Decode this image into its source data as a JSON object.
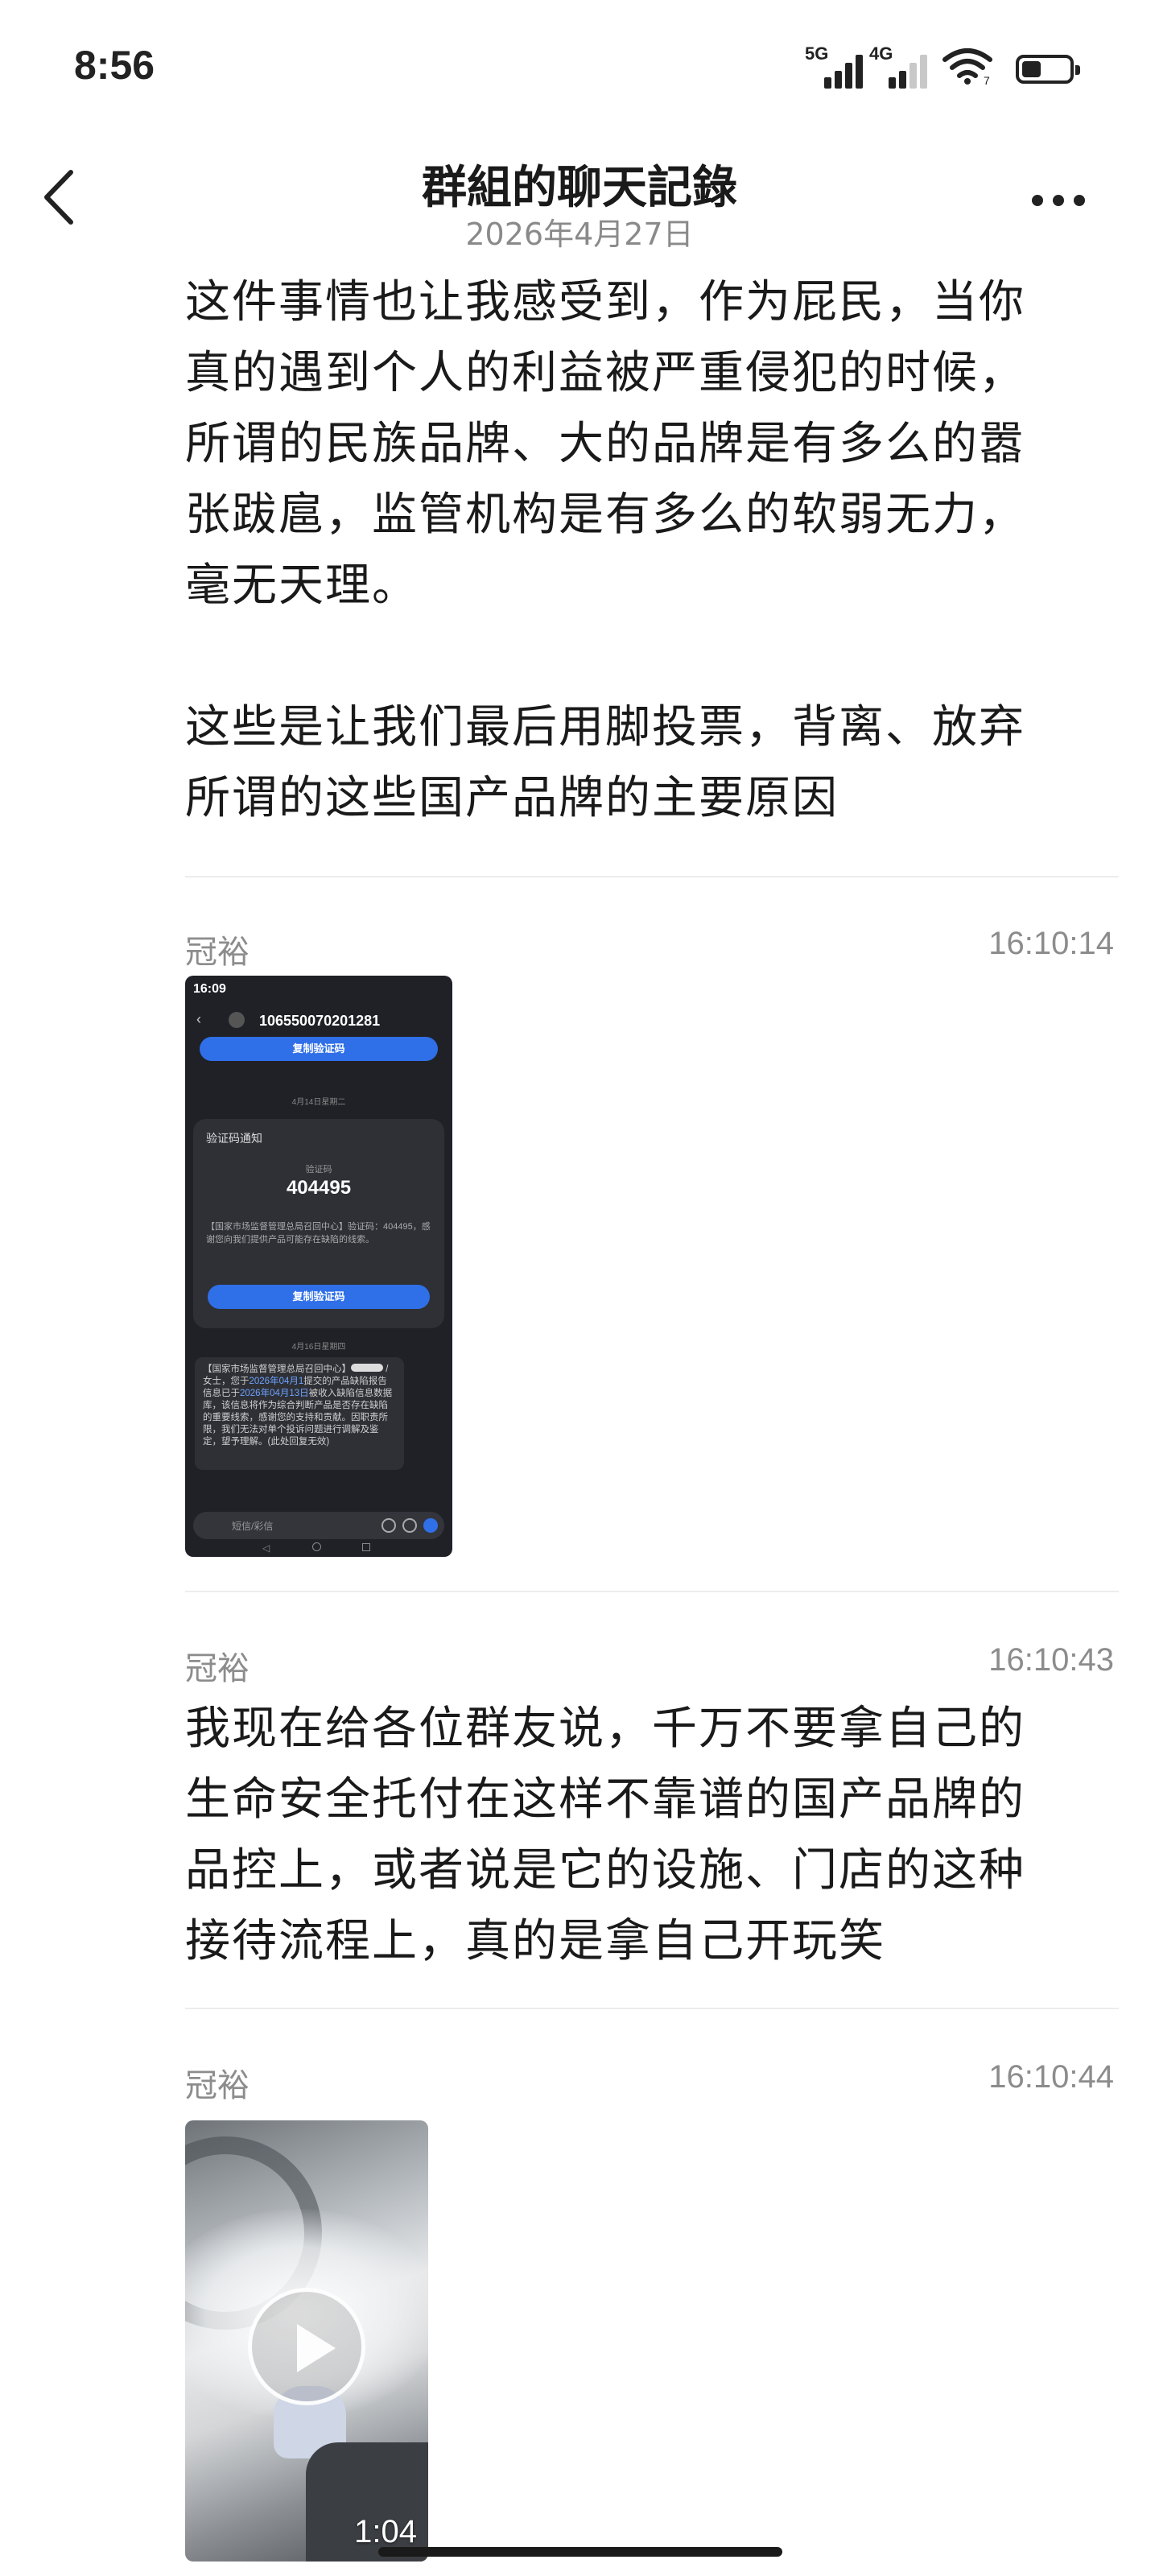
{
  "status_bar": {
    "time": "8:56",
    "network_1": "5G",
    "network_2": "4G",
    "wifi_sub": "7"
  },
  "header": {
    "title": "群組的聊天記錄",
    "date": "2026年4月27日"
  },
  "messages": [
    {
      "type": "text",
      "paragraph_1": [
        "这件事情也让我感受到，作为屁民，当你",
        "真的遇到个人的利益被严重侵犯的时候，",
        "所谓的民族品牌、大的品牌是有多么的嚣",
        "张跋扈，监管机构是有多么的软弱无力，",
        "毫无天理。"
      ],
      "paragraph_2": [
        "这些是让我们最后用脚投票，背离、放弃",
        "所谓的这些国产品牌的主要原因"
      ]
    },
    {
      "type": "image",
      "sender": "冠裕",
      "time": "16:10:14",
      "screenshot": {
        "status_time": "16:09",
        "phone_number": "106550070201281",
        "copy_button": "复制验证码",
        "date_divider_1": "4月14日星期二",
        "card_title": "验证码通知",
        "code_label": "验证码",
        "code": "404495",
        "card_text": "【国家市场监督管理总局召回中心】验证码：404495，感谢您向我们提供产品可能存在缺陷的线索。",
        "copy_button_2": "复制验证码",
        "date_divider_2": "4月16日星期四",
        "bubble_text_1": "【国家市场监督管理总局召回中心】",
        "bubble_text_2": "/女士，您于",
        "bubble_link_1": "2026年04月1",
        "bubble_text_3": "提交的产品缺陷报告信息已于",
        "bubble_link_2": "2026年04月13日",
        "bubble_text_4": "被收入缺陷信息数据库，该信息将作为综合判断产品是否存在缺陷的重要线索，感谢您的支持和贡献。因职责所限，我们无法对单个投诉问题进行调解及鉴定，望予理解。(此处回复无效)",
        "input_placeholder": "短信/彩信"
      }
    },
    {
      "type": "text",
      "sender": "冠裕",
      "time": "16:10:43",
      "lines": [
        "我现在给各位群友说，千万不要拿自己的",
        "生命安全托付在这样不靠谱的国产品牌的",
        "品控上，或者说是它的设施、门店的这种",
        "接待流程上，真的是拿自己开玩笑"
      ]
    },
    {
      "type": "video",
      "sender": "冠裕",
      "time": "16:10:44",
      "duration": "1:04"
    }
  ],
  "icons": {
    "back": "chevron-left-icon",
    "more": "more-horizontal-icon",
    "play": "play-icon"
  }
}
